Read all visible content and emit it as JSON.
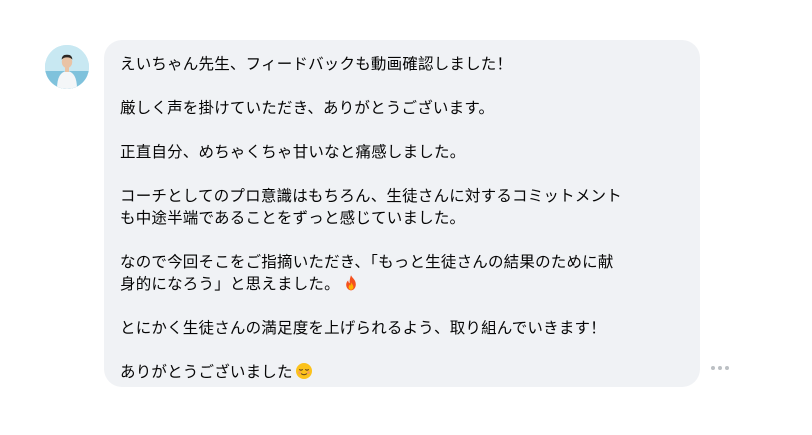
{
  "message": {
    "lines": [
      "えいちゃん先生、フィードバックも動画確認しました！",
      "",
      "厳しく声を掛けていただき、ありがとうございます。",
      "",
      "正直自分、めちゃくちゃ甘いなと痛感しました。",
      "",
      "コーチとしてのプロ意識はもちろん、生徒さんに対するコミットメント",
      "も中途半端であることをずっと感じていました。",
      "",
      "なので今回そこをご指摘いただき、「もっと生徒さんの結果のために献",
      "身的になろう」と思えました。",
      "",
      "とにかく生徒さんの満足度を上げられるよう、取り組んでいきます！",
      "",
      "ありがとうございました"
    ],
    "emoji": {
      "line_10": "fire-icon",
      "line_14": "relieved-face-icon"
    }
  },
  "colors": {
    "bubble_background": "#f0f2f5",
    "text": "#050505",
    "more_dots": "#bcc0c4"
  }
}
